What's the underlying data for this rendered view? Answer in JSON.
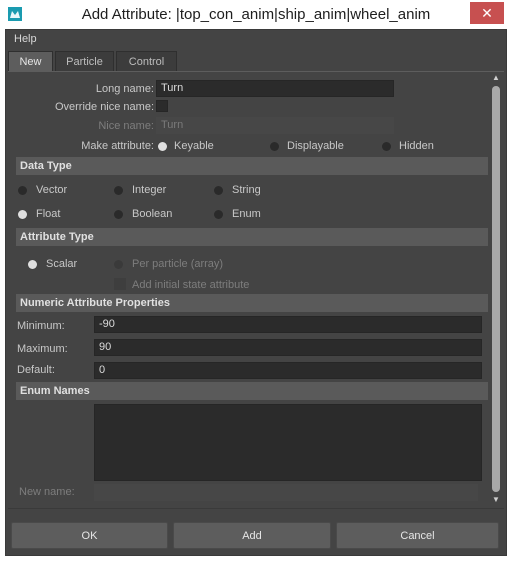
{
  "window": {
    "title": "Add Attribute: |top_con_anim|ship_anim|wheel_anim",
    "close_glyph": "✕",
    "app_icon": "maya-icon"
  },
  "menu": {
    "help": "Help"
  },
  "tabs": [
    {
      "label": "New",
      "active": true
    },
    {
      "label": "Particle",
      "active": false
    },
    {
      "label": "Control",
      "active": false
    }
  ],
  "form": {
    "long_name_label": "Long name:",
    "long_name_value": "Turn",
    "override_label": "Override nice name:",
    "nice_name_label": "Nice name:",
    "nice_name_value": "Turn",
    "make_attr_label": "Make attribute:",
    "make_attr_options": [
      "Keyable",
      "Displayable",
      "Hidden"
    ],
    "make_attr_selected": "Keyable"
  },
  "data_type": {
    "header": "Data Type",
    "options": [
      "Vector",
      "Integer",
      "String",
      "Float",
      "Boolean",
      "Enum"
    ],
    "selected": "Float"
  },
  "attribute_type": {
    "header": "Attribute Type",
    "scalar": "Scalar",
    "per_particle": "Per particle (array)",
    "initial_state": "Add initial state attribute",
    "selected": "Scalar"
  },
  "numeric": {
    "header": "Numeric Attribute Properties",
    "min_label": "Minimum:",
    "min_value": "-90",
    "max_label": "Maximum:",
    "max_value": "90",
    "default_label": "Default:",
    "default_value": "0"
  },
  "enum": {
    "header": "Enum Names",
    "new_name_label": "New name:"
  },
  "buttons": {
    "ok": "OK",
    "add": "Add",
    "cancel": "Cancel"
  },
  "colors": {
    "panel": "#444444",
    "field": "#2b2b2b",
    "section": "#5a5a5a",
    "button": "#5d5d5d",
    "close": "#c75050"
  }
}
